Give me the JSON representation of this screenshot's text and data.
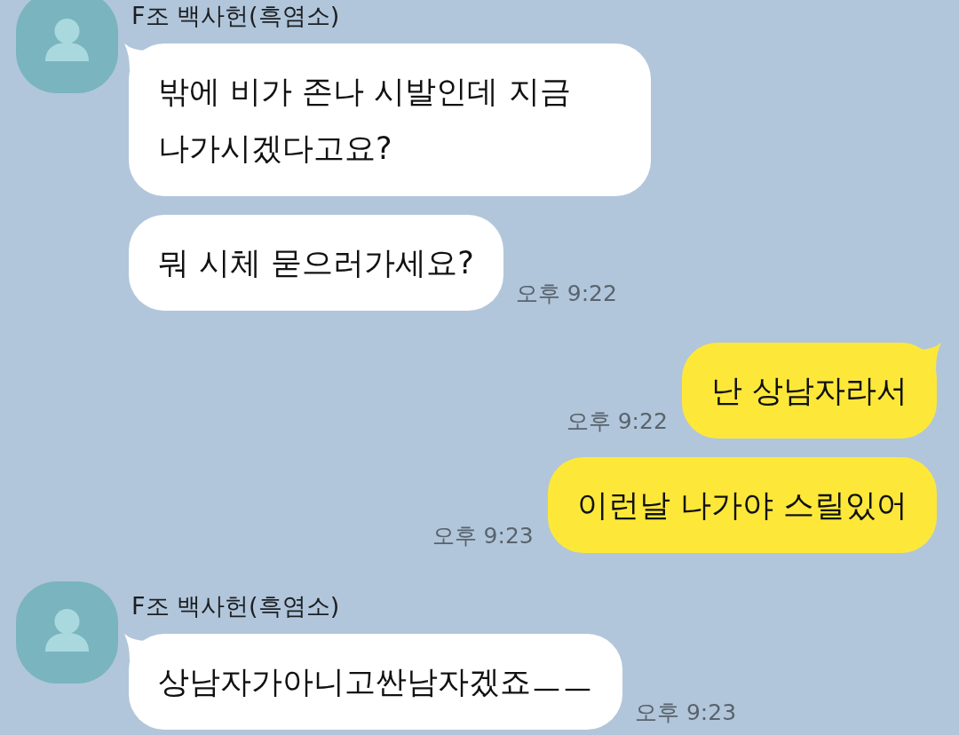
{
  "chat": {
    "groups": [
      {
        "kind": "received",
        "sender": "F조 백사헌(흑염소)",
        "messages": [
          {
            "text": "밖에 비가 존나 시발인데 지금 나가시겠다고요?"
          },
          {
            "text": "뭐 시체 묻으러가세요?",
            "time": "오후 9:22"
          }
        ]
      },
      {
        "kind": "sent",
        "messages": [
          {
            "text": "난 상남자라서",
            "time": "오후 9:22"
          },
          {
            "text": "이런날 나가야 스릴있어",
            "time": "오후 9:23"
          }
        ]
      },
      {
        "kind": "received",
        "sender": "F조 백사헌(흑염소)",
        "messages": [
          {
            "text": "상남자가아니고싼남자겠죠ㅡㅡ",
            "time": "오후 9:23"
          }
        ]
      }
    ]
  }
}
